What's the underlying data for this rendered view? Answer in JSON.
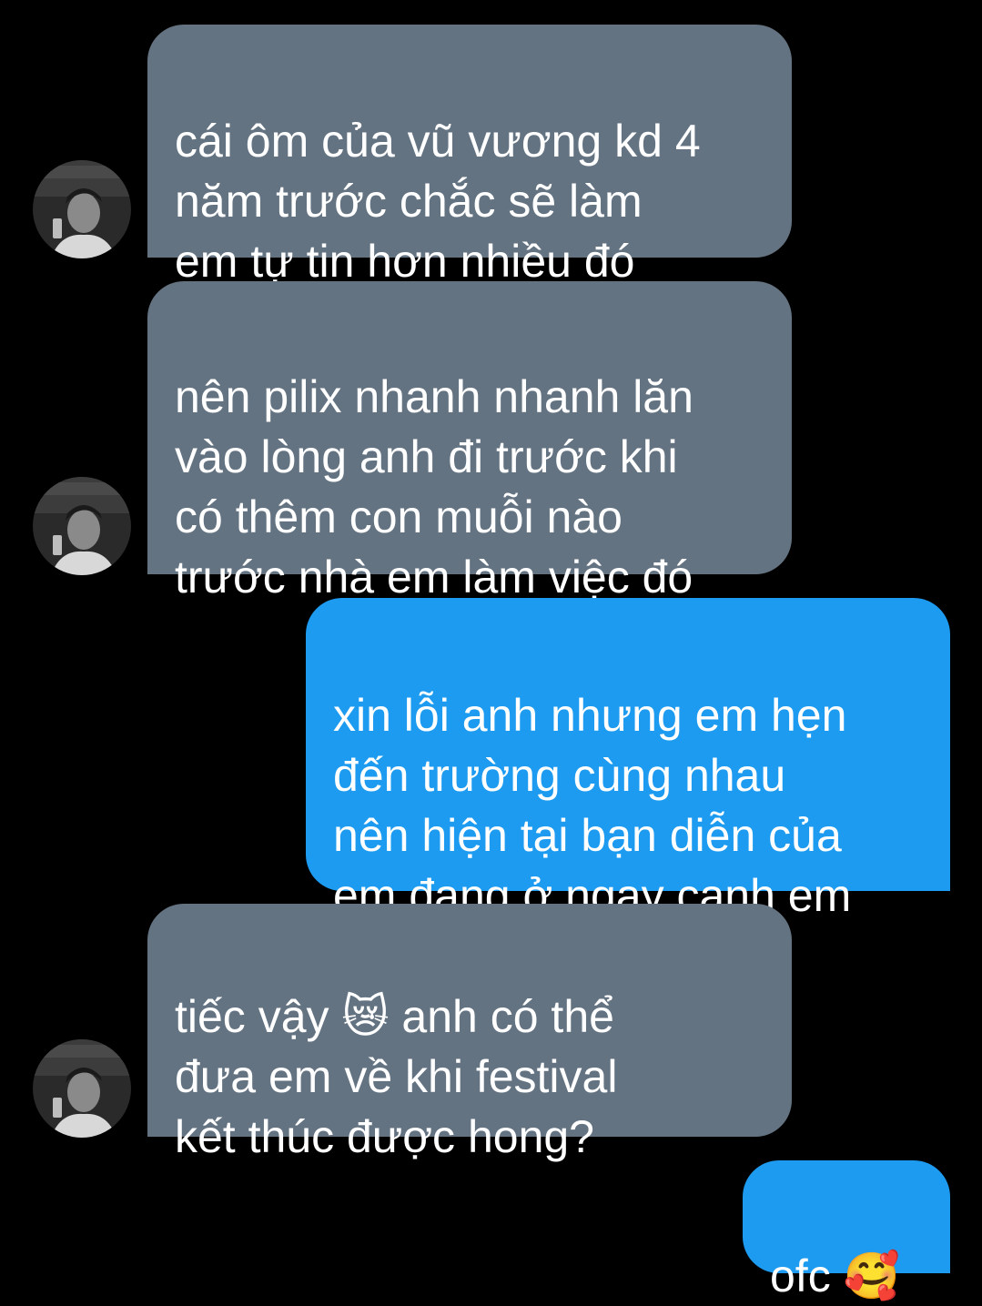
{
  "colors": {
    "background": "#000000",
    "received_bubble": "#647382",
    "sent_bubble": "#1d9bf0",
    "text": "#ffffff"
  },
  "messages": [
    {
      "direction": "received",
      "text": "cái ôm của vũ vương kd 4\nnăm trước chắc sẽ làm\nem tự tin hơn nhiều đó",
      "has_avatar": true
    },
    {
      "direction": "received",
      "text": "nên pilix nhanh nhanh lăn\nvào lòng anh đi trước khi\ncó thêm con muỗi nào\ntrước nhà em làm việc đó",
      "has_avatar": true
    },
    {
      "direction": "sent",
      "text": "xin lỗi anh nhưng em hẹn\nđến trường cùng nhau\nnên hiện tại bạn diễn của\nem đang ở ngay cạnh em"
    },
    {
      "direction": "received",
      "text": "tiếc vậy 😿 anh có thể\nđưa em về khi festival\nkết thúc được hong?",
      "emoji_icon": "crying-cat-face-icon",
      "has_avatar": true
    },
    {
      "direction": "sent",
      "text": "ofc 🥰",
      "emoji_icon": "smiling-face-with-hearts-icon"
    }
  ]
}
